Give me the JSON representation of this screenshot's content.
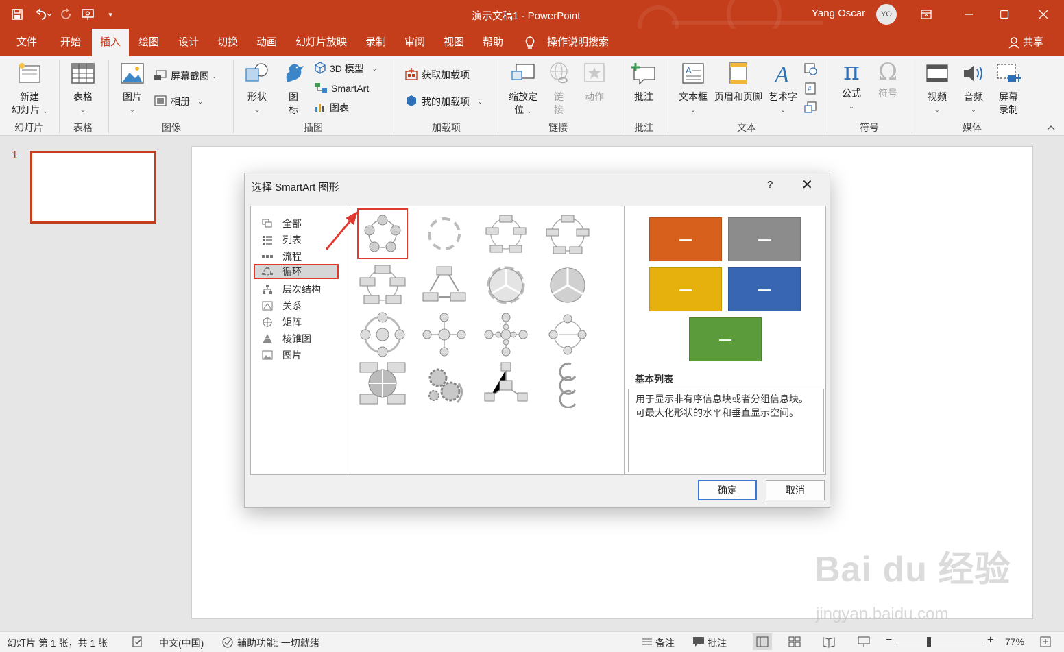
{
  "window": {
    "title": "演示文稿1 - PowerPoint",
    "user_name": "Yang Oscar",
    "avatar_initials": "YO",
    "accent_color": "#c43e1c"
  },
  "tabs": [
    "文件",
    "开始",
    "插入",
    "绘图",
    "设计",
    "切换",
    "动画",
    "幻灯片放映",
    "录制",
    "审阅",
    "视图",
    "帮助"
  ],
  "active_tab": "插入",
  "tell_me": "操作说明搜索",
  "share": "共享",
  "ribbon": {
    "new_slide_1": "新建",
    "new_slide_2": "幻灯片",
    "table": "表格",
    "pictures": "图片",
    "screenshot": "屏幕截图",
    "album": "相册",
    "shapes": "形状",
    "icons_1": "图",
    "icons_2": "标",
    "model3d": "3D 模型",
    "smartart": "SmartArt",
    "chart": "图表",
    "get_addins": "获取加载项",
    "my_addins": "我的加载项",
    "zoom_1": "缩放定",
    "zoom_2": "位",
    "link_1": "链",
    "link_2": "接",
    "action": "动作",
    "comment": "批注",
    "textbox": "文本框",
    "header_footer": "页眉和页脚",
    "wordart": "艺术字",
    "equation": "公式",
    "symbol": "符号",
    "video": "视频",
    "audio": "音频",
    "screen_rec_1": "屏幕",
    "screen_rec_2": "录制",
    "groups": {
      "slides": "幻灯片",
      "tables": "表格",
      "images": "图像",
      "illustrations": "插图",
      "addins": "加载项",
      "links": "链接",
      "comments": "批注",
      "text": "文本",
      "symbols": "符号",
      "media": "媒体"
    }
  },
  "slides_pane": {
    "slide_number": "1"
  },
  "dialog": {
    "title": "选择 SmartArt 图形",
    "help": "?",
    "categories": [
      "全部",
      "列表",
      "流程",
      "循环",
      "层次结构",
      "关系",
      "矩阵",
      "棱锥图",
      "图片"
    ],
    "selected_category": "循环",
    "preview_title": "基本列表",
    "preview_desc": "用于显示非有序信息块或者分组信息块。可最大化形状的水平和垂直显示空间。",
    "preview_colors": [
      "#d6601c",
      "#8c8c8c",
      "#e7b10d",
      "#3866b3",
      "#5c9b3b"
    ],
    "ok": "确定",
    "cancel": "取消"
  },
  "status": {
    "slide_info": "幻灯片 第 1 张，共 1 张",
    "language": "中文(中国)",
    "accessibility": "辅助功能: 一切就绪",
    "notes": "备注",
    "comments": "批注",
    "zoom": "77%"
  },
  "watermark": {
    "brand": "Bai du 经验",
    "url": "jingyan.baidu.com"
  }
}
